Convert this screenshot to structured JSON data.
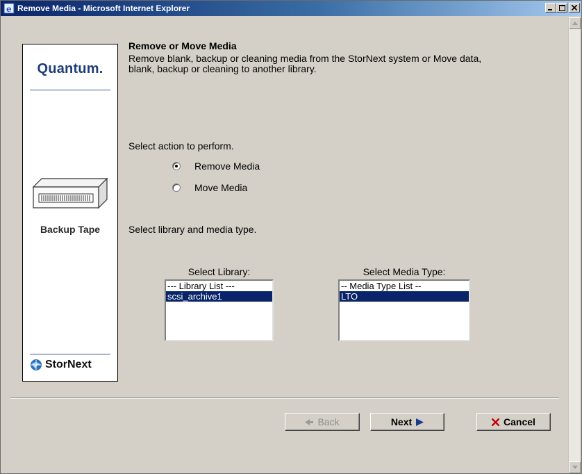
{
  "window": {
    "title": "Remove Media - Microsoft Internet Explorer",
    "minimize": "_",
    "maximize": "□",
    "close": "×"
  },
  "sidebar": {
    "logo": "Quantum.",
    "caption": "Backup Tape",
    "brand": "StorNext"
  },
  "main": {
    "heading": "Remove or Move Media",
    "description": "Remove blank, backup or cleaning media from the StorNext system or Move data, blank, backup or cleaning to another library.",
    "action_label": "Select action to perform.",
    "actions": [
      {
        "label": "Remove Media",
        "checked": true
      },
      {
        "label": "Move Media",
        "checked": false
      }
    ],
    "library_media_label": "Select library and media type.",
    "library": {
      "label": "Select Library:",
      "options": [
        "--- Library List ---",
        "scsi_archive1"
      ],
      "selected": "scsi_archive1"
    },
    "media_type": {
      "label": "Select Media Type:",
      "options": [
        "-- Media Type List --",
        "LTO"
      ],
      "selected": "LTO"
    }
  },
  "buttons": {
    "back": "Back",
    "next": "Next",
    "cancel": "Cancel"
  },
  "colors": {
    "title_bar": "#0a246a",
    "selection": "#0a246a",
    "cancel_x": "#c00000",
    "next_arrow": "#1a3a8a"
  }
}
